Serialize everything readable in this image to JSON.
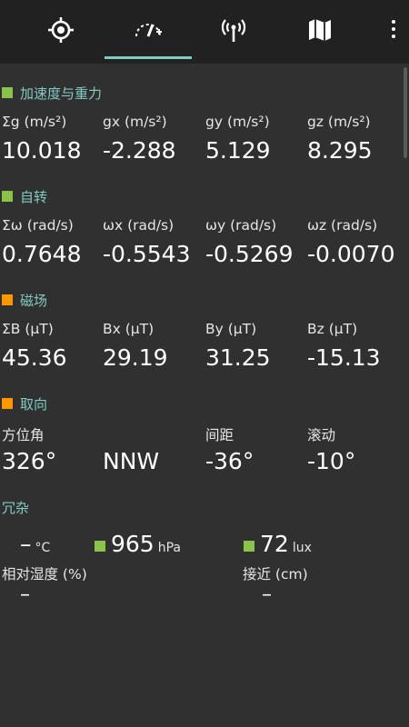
{
  "colors": {
    "green": "#8bc34a",
    "orange": "#ff9800",
    "teal": "#80cbc4",
    "background": "#303030",
    "topbar": "#212121"
  },
  "tabs": [
    {
      "icon": "gps-target-icon",
      "active": false
    },
    {
      "icon": "gauge-icon",
      "active": true
    },
    {
      "icon": "antenna-icon",
      "active": false
    },
    {
      "icon": "map-icon",
      "active": false
    }
  ],
  "menu": {
    "icon": "more-vertical-icon"
  },
  "acceleration": {
    "title": "加速度与重力",
    "labels": [
      "Σg (m/s²)",
      "gx (m/s²)",
      "gy (m/s²)",
      "gz (m/s²)"
    ],
    "values": [
      "10.018",
      "-2.288",
      "5.129",
      "8.295"
    ]
  },
  "rotation": {
    "title": "自转",
    "labels": [
      "Σω (rad/s)",
      "ωx (rad/s)",
      "ωy (rad/s)",
      "ωz (rad/s)"
    ],
    "values": [
      "0.7648",
      "-0.5543",
      "-0.5269",
      "-0.0070"
    ]
  },
  "magnetic": {
    "title": "磁场",
    "labels": [
      "ΣB (μT)",
      "Bx (μT)",
      "By (μT)",
      "Bz (μT)"
    ],
    "values": [
      "45.36",
      "29.19",
      "31.25",
      "-15.13"
    ]
  },
  "orientation": {
    "title": "取向",
    "labels": [
      "方位角",
      "间距",
      "滚动"
    ],
    "values": [
      "326°",
      "NNW",
      "-36°",
      "-10°"
    ]
  },
  "misc": {
    "title": "冗杂",
    "temperature": {
      "value": "–",
      "unit": "°C"
    },
    "pressure": {
      "value": "965",
      "unit": "hPa"
    },
    "light": {
      "value": "72",
      "unit": "lux"
    },
    "humidity": {
      "label": "相对湿度 (%)",
      "value": "–"
    },
    "proximity": {
      "label": "接近 (cm)",
      "value": "–"
    }
  }
}
